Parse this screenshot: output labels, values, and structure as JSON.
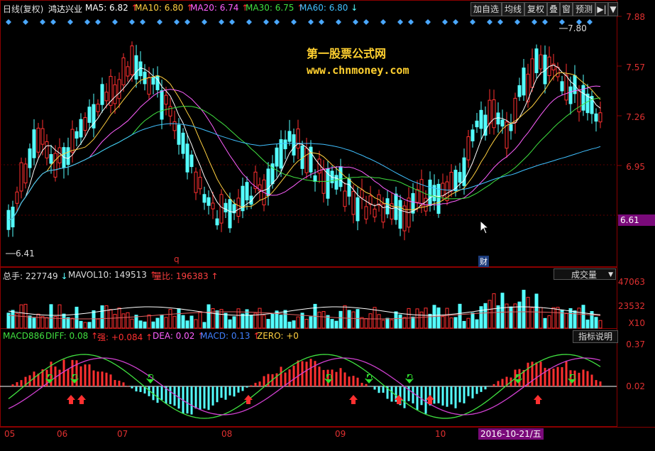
{
  "header": {
    "period": "日线(复权)",
    "stock_name": "鸿达兴业",
    "ma": [
      {
        "label": "MA5: 6.82",
        "arrow": "↑",
        "color": "#ffffff"
      },
      {
        "label": "MA10: 6.80",
        "arrow": "↑",
        "color": "#ffd040"
      },
      {
        "label": "MA20: 6.74",
        "arrow": "↑",
        "color": "#ff60ff"
      },
      {
        "label": "MA30: 6.75",
        "arrow": "↑",
        "color": "#40e040"
      },
      {
        "label": "MA60: 6.80",
        "arrow": "↓",
        "color": "#40c0ff"
      }
    ]
  },
  "toolbar": {
    "add_watch": "加自选",
    "ma_line": "均线",
    "adjust": "复权",
    "overlay": "叠",
    "window": "窗",
    "forecast": "预测",
    "nav_icon": "play-next-icon",
    "menu_icon": "dropdown-icon"
  },
  "watermark": {
    "title": "第一股票公式网",
    "url": "www.chnmoney.com"
  },
  "price_axis": {
    "ticks": [
      "7.88",
      "7.57",
      "7.26",
      "6.95",
      "6.61"
    ],
    "current": "6.61",
    "high_marker": "7.80",
    "low_marker": "6.41"
  },
  "markers": {
    "q_mark": "q",
    "cai_mark": "财"
  },
  "volume": {
    "total": "总手: 227749",
    "total_arrow": "↓",
    "mavol": "MAVOL10: 149513",
    "mavol_arrow": "↑",
    "ratio": "量比: 196383",
    "ratio_arrow": "↑",
    "selector": "成交量",
    "ticks": [
      "47063",
      "23532",
      "X10"
    ]
  },
  "macd": {
    "name": "MACD886",
    "diff": "DIFF: 0.08",
    "diff_arrow": "↑",
    "strong": "强: +0.084",
    "strong_arrow": "↑",
    "dea": "DEA: 0.02",
    "dea_arrow": "↑",
    "macd": "MACD: 0.13",
    "macd_arrow": "↑",
    "zero": "ZERO: +0",
    "help_button": "指标说明",
    "ticks": [
      "0.37",
      "0.02"
    ]
  },
  "x_axis": {
    "months": [
      "05",
      "06",
      "07",
      "08",
      "09",
      "10"
    ],
    "cursor_date": "2016-10-21/五"
  },
  "colors": {
    "up": "#ff3030",
    "down": "#54ffff",
    "grid": "#8b0000",
    "axis_text": "#e03030"
  }
}
